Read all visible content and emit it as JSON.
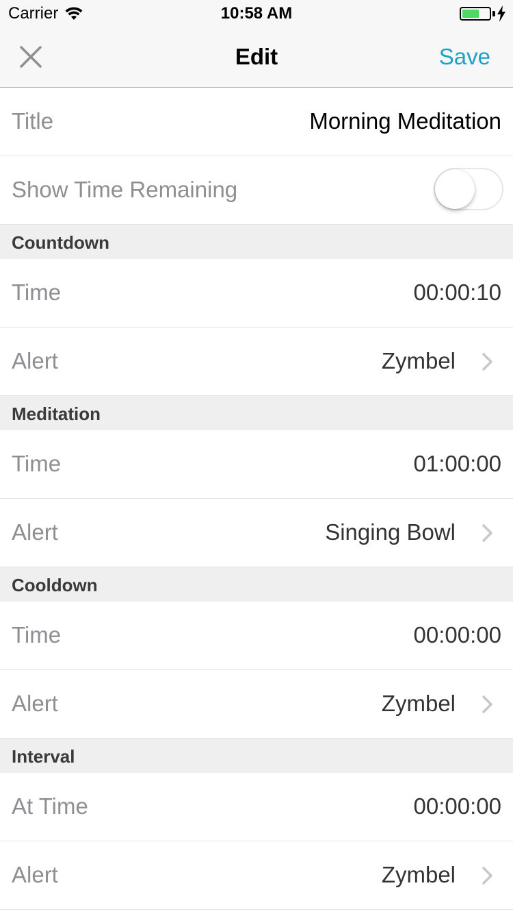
{
  "status_bar": {
    "carrier": "Carrier",
    "time": "10:58 AM",
    "battery_color": "#4cd964"
  },
  "nav": {
    "close_icon": "close-x",
    "title": "Edit",
    "save_label": "Save",
    "accent_color": "#1aa3c8"
  },
  "title_row": {
    "label": "Title",
    "value": "Morning Meditation"
  },
  "show_time_row": {
    "label": "Show Time Remaining",
    "toggle_on": false
  },
  "sections": [
    {
      "header": "Countdown",
      "time_label": "Time",
      "time_value": "00:00:10",
      "alert_label": "Alert",
      "alert_value": "Zymbel"
    },
    {
      "header": "Meditation",
      "time_label": "Time",
      "time_value": "01:00:00",
      "alert_label": "Alert",
      "alert_value": "Singing Bowl"
    },
    {
      "header": "Cooldown",
      "time_label": "Time",
      "time_value": "00:00:00",
      "alert_label": "Alert",
      "alert_value": "Zymbel"
    },
    {
      "header": "Interval",
      "time_label": "At Time",
      "time_value": "00:00:00",
      "alert_label": "Alert",
      "alert_value": "Zymbel"
    }
  ]
}
